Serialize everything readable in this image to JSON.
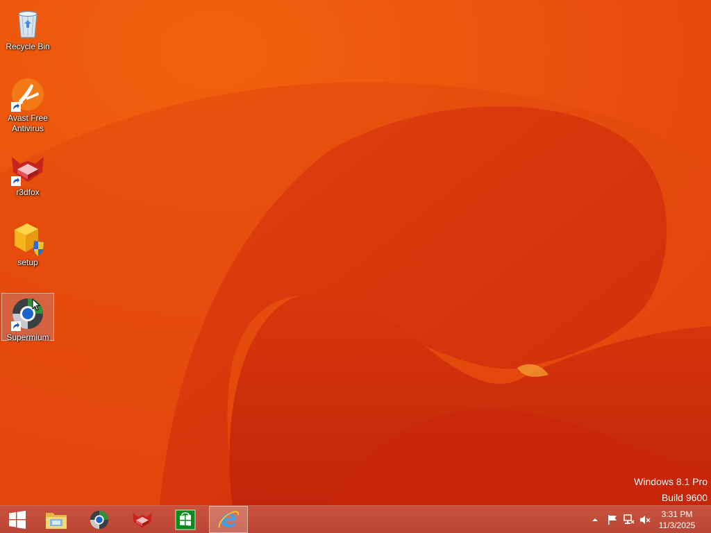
{
  "desktop": {
    "icons": [
      {
        "label": "Recycle Bin",
        "icon": "recycle-bin-icon",
        "shortcut": false
      },
      {
        "label": "Avast Free Antivirus",
        "icon": "avast-icon",
        "shortcut": true
      },
      {
        "label": "r3dfox",
        "icon": "r3dfox-icon",
        "shortcut": true
      },
      {
        "label": "setup",
        "icon": "setup-icon",
        "shortcut": false
      },
      {
        "label": "Supermium",
        "icon": "supermium-icon",
        "shortcut": true,
        "selected": true
      }
    ]
  },
  "watermark": {
    "line1": "Windows 8.1 Pro",
    "line2": "Build 9600"
  },
  "taskbar": {
    "buttons": [
      {
        "name": "start-button",
        "icon": "windows-logo-icon"
      },
      {
        "name": "file-explorer-button",
        "icon": "folder-icon"
      },
      {
        "name": "supermium-taskbar-button",
        "icon": "supermium-icon"
      },
      {
        "name": "r3dfox-taskbar-button",
        "icon": "r3dfox-icon"
      },
      {
        "name": "store-button",
        "icon": "store-icon"
      },
      {
        "name": "internet-explorer-button",
        "icon": "ie-icon",
        "active": true
      }
    ],
    "tray": {
      "icons": [
        "show-hidden-icons-icon",
        "action-center-flag-icon",
        "network-icon",
        "volume-muted-icon"
      ]
    },
    "clock": {
      "time": "3:31 PM",
      "date": "11/3/2025"
    }
  },
  "colors": {
    "wallpaper_base": "#e8460c",
    "wallpaper_dark": "#d2310a",
    "taskbar": "#c24c3a",
    "text": "#ffffff"
  }
}
